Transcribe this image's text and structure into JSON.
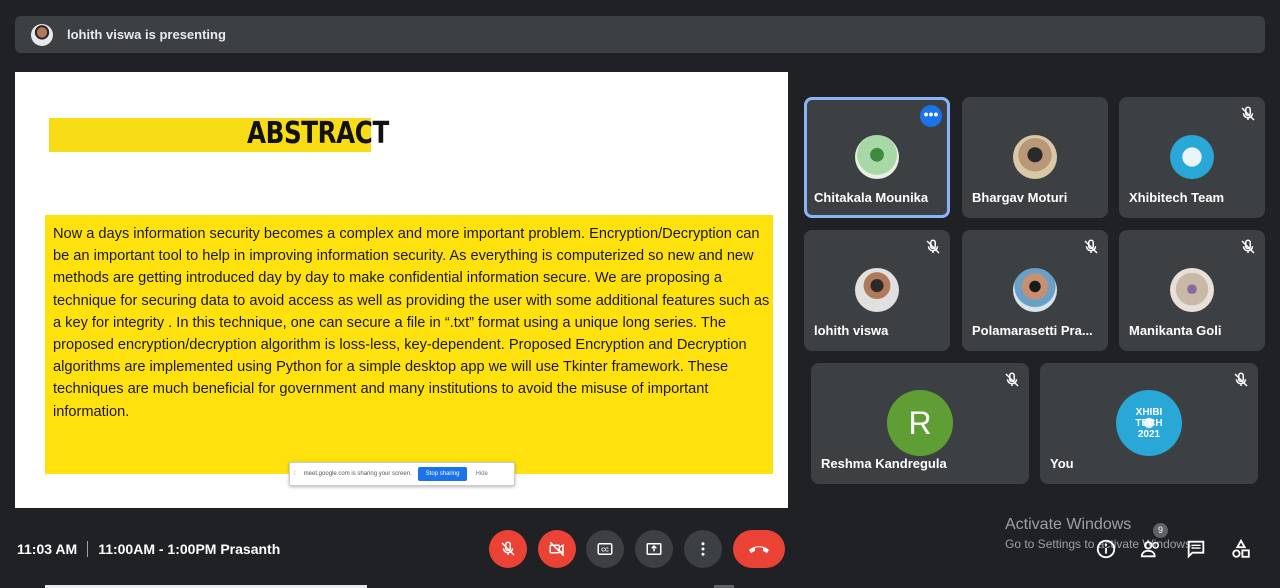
{
  "banner": {
    "presenter_text": "lohith viswa is presenting"
  },
  "slide": {
    "title": "ABSTRACT",
    "body": "Now a days information security becomes a complex and more important problem. Encryption/Decryption can be an important tool to help in improving information security. As everything is computerized so new and new methods are getting introduced day by day to make confidential information secure. We are proposing a technique for securing data to avoid access  as well as providing the user with some additional features such as a key for integrity . In this technique, one can secure a file in “.txt” format using a unique long series. The proposed encryption/decryption algorithm is loss-less, key-dependent. Proposed Encryption and Decryption algorithms are implemented using Python for a simple desktop app we will use Tkinter framework. These techniques are much beneficial for  government and many institutions to avoid the misuse of important information.",
    "share_bar": {
      "message": "meet.google.com is sharing your screen.",
      "stop_label": "Stop sharing",
      "hide_label": "Hide"
    }
  },
  "participants": [
    {
      "name": "Chitakala Mounika",
      "avatar_color": "#7ab87a"
    },
    {
      "name": "Bhargav Moturi",
      "avatar_color": "#8a6a4a"
    },
    {
      "name": "Xhibitech Team",
      "avatar_color": "#29a8d8"
    },
    {
      "name": "lohith viswa",
      "avatar_color": "#d8d8d8"
    },
    {
      "name": "Polamarasetti Pra...",
      "avatar_color": "#6aa0c8"
    },
    {
      "name": "Manikanta Goli",
      "avatar_color": "#c8b8a8"
    },
    {
      "name": "Reshma Kandregula",
      "initial": "R",
      "avatar_color": "#5f9e35"
    },
    {
      "name": "You",
      "avatar_color": "#29a8d8"
    }
  ],
  "xhibi_logo": {
    "line1": "XHIBI",
    "line2": "TECH",
    "line3": "2021"
  },
  "footer": {
    "time": "11:03 AM",
    "meeting": "11:00AM - 1:00PM Prasanth"
  },
  "watermark": {
    "line1": "Activate Windows",
    "line2": "Go to Settings to activate Windows."
  },
  "people_count": "9",
  "colors": {
    "accent": "#1a73e8",
    "danger": "#ea4335",
    "tile_bg": "#3c4043",
    "slide_highlight": "#ffe10d"
  }
}
